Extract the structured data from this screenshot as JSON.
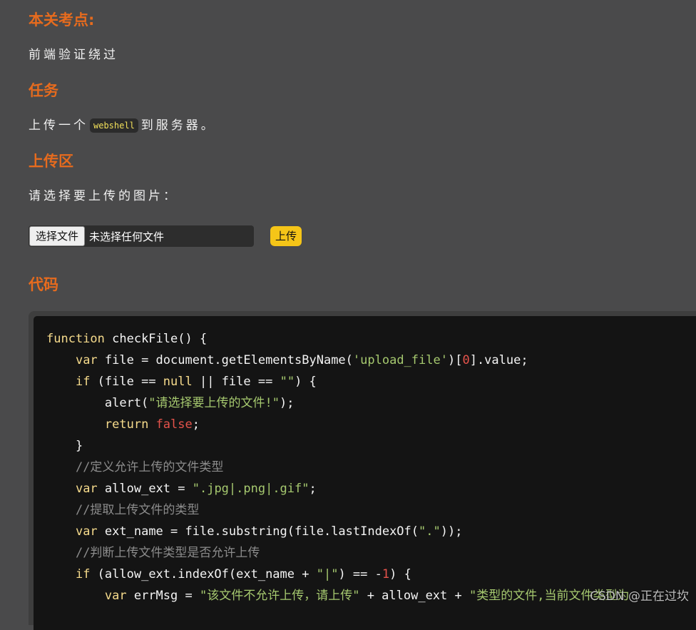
{
  "sections": {
    "key_point": {
      "heading": "本关考点:",
      "text": "前端验证绕过"
    },
    "task": {
      "heading": "任务",
      "prefix": "上传一个",
      "code": "webshell",
      "suffix": "到服务器。"
    },
    "upload": {
      "heading": "上传区",
      "prompt": "请选择要上传的图片：",
      "choose_button": "选择文件",
      "file_status": "未选择任何文件",
      "upload_button": "上传"
    },
    "code": {
      "heading": "代码"
    }
  },
  "code_lines": [
    [
      {
        "t": "kw",
        "v": "function"
      },
      {
        "t": "",
        "v": " checkFile() {"
      }
    ],
    [
      {
        "t": "",
        "v": "    "
      },
      {
        "t": "kw",
        "v": "var"
      },
      {
        "t": "",
        "v": " file = document.getElementsByName("
      },
      {
        "t": "str",
        "v": "'upload_file'"
      },
      {
        "t": "",
        "v": ")["
      },
      {
        "t": "num",
        "v": "0"
      },
      {
        "t": "",
        "v": "].value;"
      }
    ],
    [
      {
        "t": "",
        "v": "    "
      },
      {
        "t": "kw",
        "v": "if"
      },
      {
        "t": "",
        "v": " (file == "
      },
      {
        "t": "kw",
        "v": "null"
      },
      {
        "t": "",
        "v": " || file == "
      },
      {
        "t": "str",
        "v": "\"\""
      },
      {
        "t": "",
        "v": ") {"
      }
    ],
    [
      {
        "t": "",
        "v": "        alert("
      },
      {
        "t": "str",
        "v": "\"请选择要上传的文件!\""
      },
      {
        "t": "",
        "v": ");"
      }
    ],
    [
      {
        "t": "",
        "v": "        "
      },
      {
        "t": "kw",
        "v": "return"
      },
      {
        "t": "",
        "v": " "
      },
      {
        "t": "bool",
        "v": "false"
      },
      {
        "t": "",
        "v": ";"
      }
    ],
    [
      {
        "t": "",
        "v": "    }"
      }
    ],
    [
      {
        "t": "",
        "v": "    "
      },
      {
        "t": "cm",
        "v": "//定义允许上传的文件类型"
      }
    ],
    [
      {
        "t": "",
        "v": "    "
      },
      {
        "t": "kw",
        "v": "var"
      },
      {
        "t": "",
        "v": " allow_ext = "
      },
      {
        "t": "str",
        "v": "\".jpg|.png|.gif\""
      },
      {
        "t": "",
        "v": ";"
      }
    ],
    [
      {
        "t": "",
        "v": "    "
      },
      {
        "t": "cm",
        "v": "//提取上传文件的类型"
      }
    ],
    [
      {
        "t": "",
        "v": "    "
      },
      {
        "t": "kw",
        "v": "var"
      },
      {
        "t": "",
        "v": " ext_name = file.substring(file.lastIndexOf("
      },
      {
        "t": "str",
        "v": "\".\""
      },
      {
        "t": "",
        "v": "));"
      }
    ],
    [
      {
        "t": "",
        "v": "    "
      },
      {
        "t": "cm",
        "v": "//判断上传文件类型是否允许上传"
      }
    ],
    [
      {
        "t": "",
        "v": "    "
      },
      {
        "t": "kw",
        "v": "if"
      },
      {
        "t": "",
        "v": " (allow_ext.indexOf(ext_name + "
      },
      {
        "t": "str",
        "v": "\"|\""
      },
      {
        "t": "",
        "v": ") == -"
      },
      {
        "t": "num",
        "v": "1"
      },
      {
        "t": "",
        "v": ") {"
      }
    ],
    [
      {
        "t": "",
        "v": "        "
      },
      {
        "t": "kw",
        "v": "var"
      },
      {
        "t": "",
        "v": " errMsg = "
      },
      {
        "t": "str",
        "v": "\"该文件不允许上传，请上传\""
      },
      {
        "t": "",
        "v": " + allow_ext + "
      },
      {
        "t": "str",
        "v": "\"类型的文件,当前文件类型为"
      }
    ]
  ],
  "watermark": "CSDN @正在过坎"
}
